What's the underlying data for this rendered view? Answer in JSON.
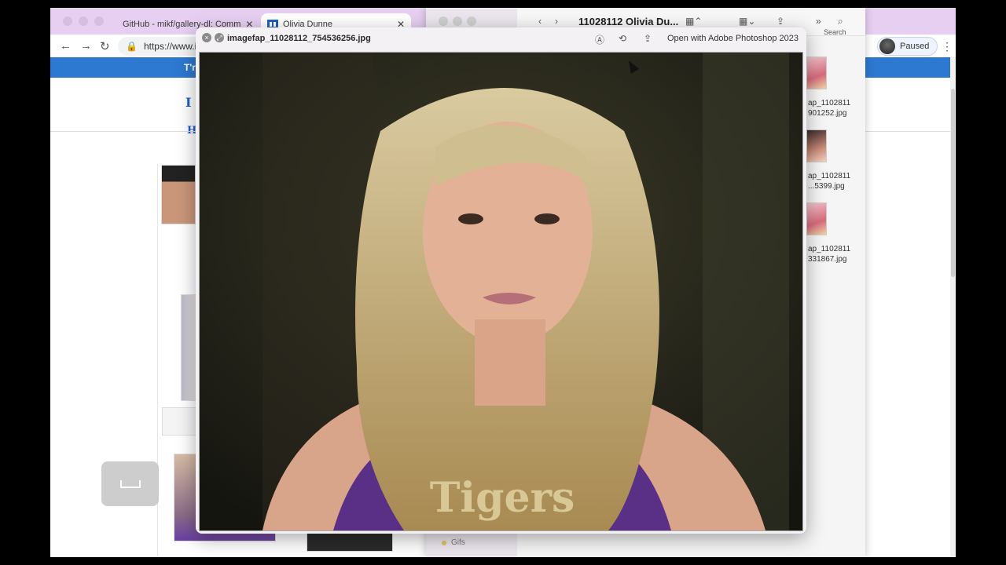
{
  "browser": {
    "tabs": [
      {
        "label": "GitHub - mikf/gallery-dl: Comm",
        "favicon": "github-icon"
      },
      {
        "label": "Olivia Dunne",
        "favicon": "imagefap-icon"
      }
    ],
    "url": "https://www.i",
    "profile_status": "Paused",
    "banner_fragment": "T'r",
    "heading_fragment": "I",
    "nav_fragment": "H"
  },
  "finder": {
    "title": "11028112 Olivia Du...",
    "search_label": "Search",
    "files": [
      {
        "line1": "ap_1102811",
        "line2": "901252.jpg"
      },
      {
        "line1": "ap_1102811",
        "line2": "...5399.jpg"
      },
      {
        "line1": "ap_1102811",
        "line2": "331867.jpg"
      }
    ],
    "sidebar_item": "Gifs"
  },
  "quicklook": {
    "filename": "imagefap_11028112_754536256.jpg",
    "open_with": "Open with Adobe Photoshop 2023",
    "jersey_text": "Tigers"
  },
  "colors": {
    "tabbar": "#e6cff1",
    "banner": "#2d78d1"
  }
}
